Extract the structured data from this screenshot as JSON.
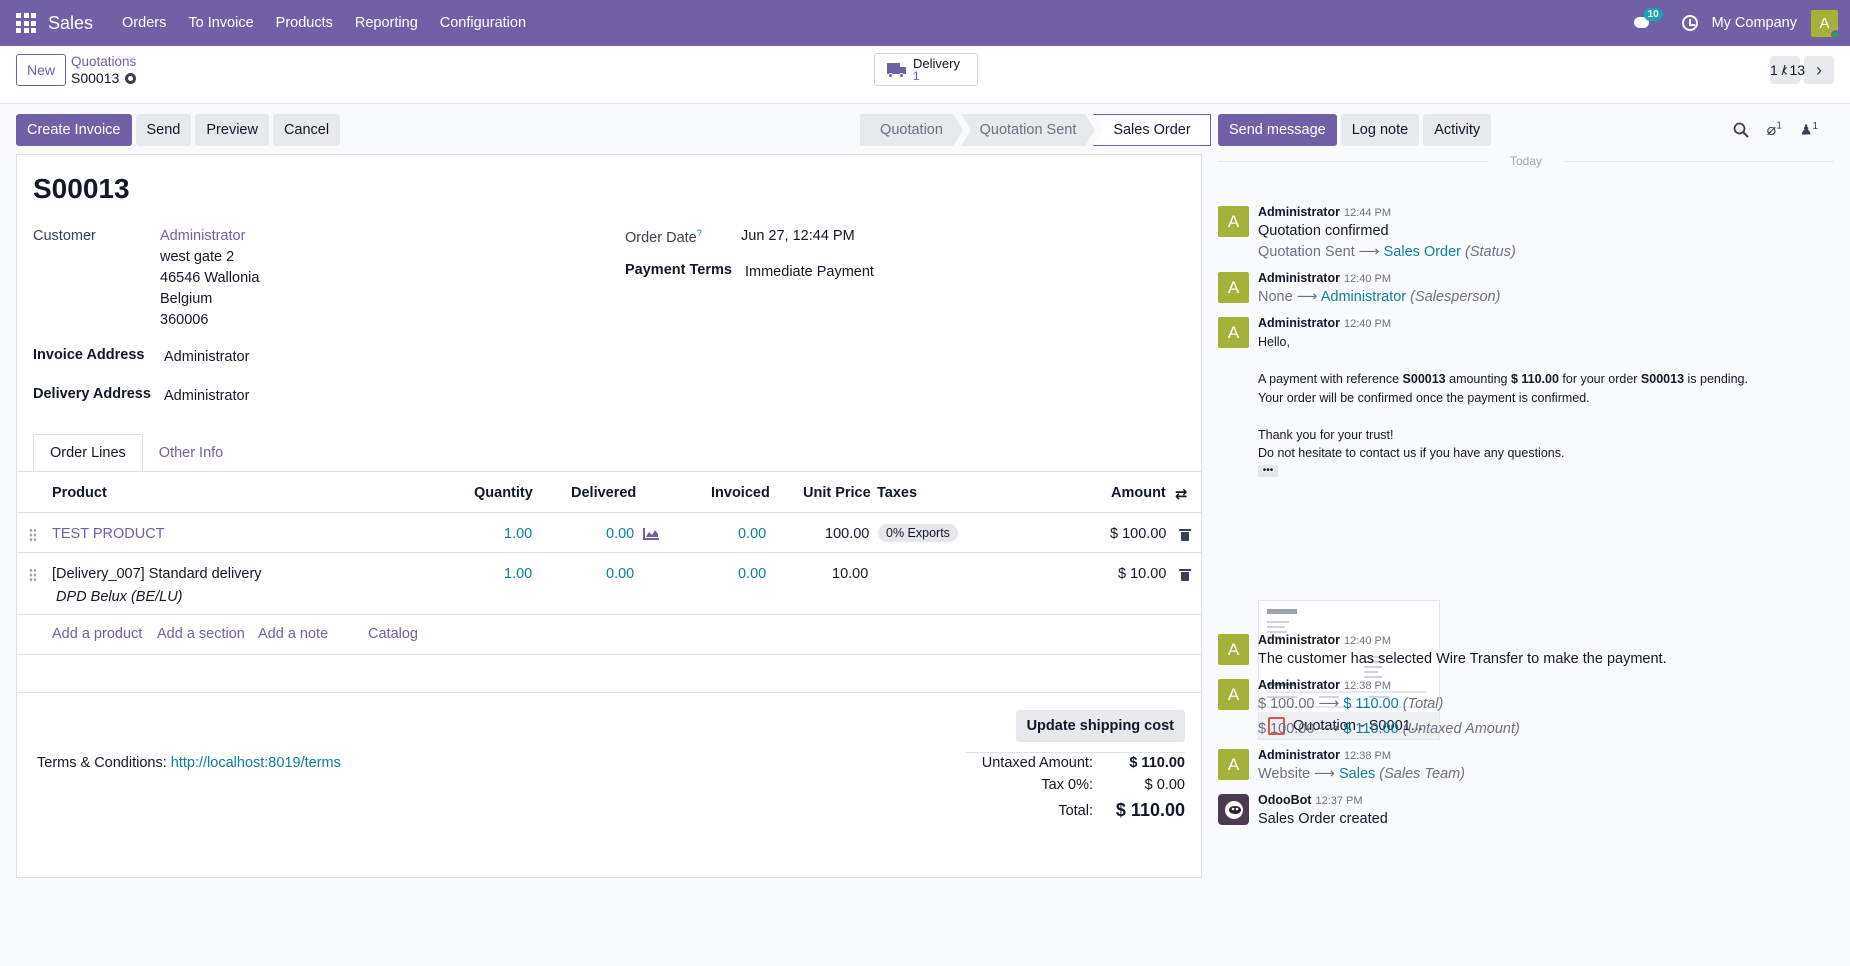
{
  "topbar": {
    "app_name": "Sales",
    "menu": [
      "Orders",
      "To Invoice",
      "Products",
      "Reporting",
      "Configuration"
    ],
    "chat_count": "10",
    "company": "My Company",
    "user_initial": "A"
  },
  "control": {
    "new_label": "New",
    "breadcrumb_parent": "Quotations",
    "breadcrumb_current": "S00013",
    "delivery_label": "Delivery",
    "delivery_count": "1",
    "pager": "1 / 13"
  },
  "actions": [
    "Create Invoice",
    "Send",
    "Preview",
    "Cancel"
  ],
  "statusbar": [
    "Quotation",
    "Quotation Sent",
    "Sales Order"
  ],
  "order": {
    "name": "S00013",
    "customer_label": "Customer",
    "customer_name": "Administrator",
    "customer_address": [
      "west gate 2",
      "46546 Wallonia",
      "Belgium",
      "360006"
    ],
    "invoice_address_label": "Invoice Address",
    "invoice_address": "Administrator",
    "delivery_address_label": "Delivery Address",
    "delivery_address": "Administrator",
    "order_date_label": "Order Date",
    "order_date_help": "?",
    "order_date": "Jun 27, 12:44 PM",
    "payment_terms_label": "Payment Terms",
    "payment_terms": "Immediate Payment"
  },
  "tabs": [
    "Order Lines",
    "Other Info"
  ],
  "lines": {
    "headers": {
      "product": "Product",
      "quantity": "Quantity",
      "delivered": "Delivered",
      "invoiced": "Invoiced",
      "unit_price": "Unit Price",
      "taxes": "Taxes",
      "amount": "Amount"
    },
    "rows": [
      {
        "product": "TEST PRODUCT",
        "quantity": "1.00",
        "delivered": "0.00",
        "invoiced": "0.00",
        "unit_price": "100.00",
        "tax": "0% Exports",
        "amount": "$ 100.00"
      },
      {
        "product": "[Delivery_007] Standard delivery",
        "description": "DPD Belux (BE/LU)",
        "quantity": "1.00",
        "delivered": "0.00",
        "invoiced": "0.00",
        "unit_price": "10.00",
        "tax": "",
        "amount": "$ 10.00"
      }
    ],
    "add_product": "Add a product",
    "add_section": "Add a section",
    "add_note": "Add a note",
    "catalog": "Catalog"
  },
  "footer": {
    "update_shipping": "Update shipping cost",
    "terms_label": "Terms & Conditions:",
    "terms_link": "http://localhost:8019/terms",
    "untaxed_label": "Untaxed Amount:",
    "untaxed_value": "$ 110.00",
    "tax_label": "Tax 0%:",
    "tax_value": "$ 0.00",
    "total_label": "Total:",
    "total_value": "$ 110.00"
  },
  "chatter": {
    "send_message": "Send message",
    "log_note": "Log note",
    "activity": "Activity",
    "attachment_count": "1",
    "follower_count": "1",
    "today": "Today",
    "messages": [
      {
        "author": "Administrator",
        "time": "12:44 PM",
        "body": "Quotation confirmed",
        "old": "Quotation Sent",
        "new": "Sales Order",
        "field": "(Status)"
      },
      {
        "author": "Administrator",
        "time": "12:40 PM",
        "old": "None",
        "new": "Administrator",
        "field": "(Salesperson)"
      },
      {
        "author": "Administrator",
        "time": "12:40 PM",
        "greeting": "Hello,",
        "p1_a": "A payment with reference ",
        "p1_ref": "S00013",
        "p1_b": " amounting ",
        "p1_amt": "$ 110.00",
        "p1_c": " for your order ",
        "p1_order": "S00013",
        "p1_d": " is pending.",
        "p2": "Your order will be confirmed once the payment is confirmed.",
        "p3": "Thank you for your trust!",
        "p4": "Do not hesitate to contact us if you have any questions.",
        "more": "•••",
        "attachment": "Quotation - S0001..."
      },
      {
        "author": "Administrator",
        "time": "12:40 PM",
        "body": "The customer has selected Wire Transfer to make the payment."
      },
      {
        "author": "Administrator",
        "time": "12:38 PM",
        "old1": "$ 100.00",
        "new1": "$ 110.00",
        "field1": "(Total)",
        "old2": "$ 100.00",
        "new2": "$ 110.00",
        "field2": "(Untaxed Amount)"
      },
      {
        "author": "Administrator",
        "time": "12:38 PM",
        "old": "Website",
        "new": "Sales",
        "field": "(Sales Team)"
      },
      {
        "author": "OdooBot",
        "time": "12:37 PM",
        "body": "Sales Order created"
      }
    ]
  }
}
